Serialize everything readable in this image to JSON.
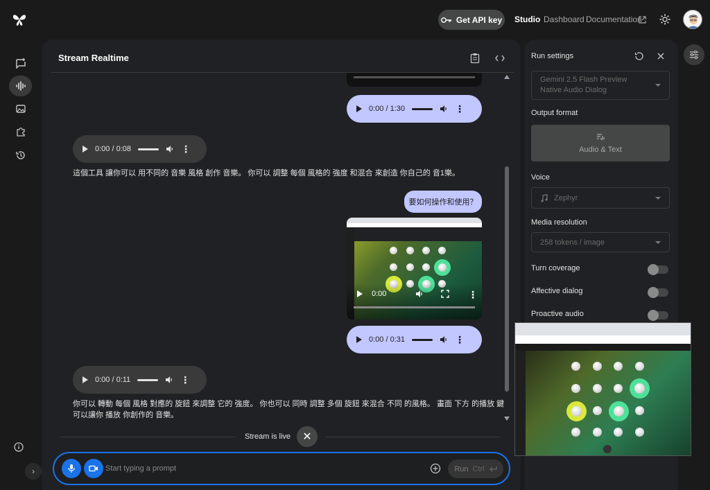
{
  "header": {
    "api_key_label": "Get API key",
    "nav": [
      "Studio",
      "Dashboard",
      "Documentation"
    ]
  },
  "main": {
    "title": "Stream Realtime",
    "messages": {
      "audio1_time": "0:00 / 1:30",
      "audio2_time": "0:00 / 0:08",
      "text1": "這個工具 讓你可以 用不同的 音樂 風格 創作 音樂。 你可以 調整 每個 風格的 強度 和混合 來創造 你自己的 音1樂。",
      "user_question": "要如何操作和使用？",
      "video_time": "0:00",
      "audio3_time": "0:00 / 0:31",
      "audio4_time": "0:00 / 0:11",
      "text2_line1": "你可以 轉動 每個 風格 對應的 旋鈕 來調整 它的 強度。 你也可以 同時 調整 多個 旋鈕 來混合 不同 的風格。 畫面 下方 的播放 鍵",
      "text2_line2": "可以讓你 播放 你創作的 音樂。"
    },
    "live_status": "Stream is live",
    "prompt_placeholder": "Start typing a prompt",
    "run_label": "Run",
    "run_shortcut": "Ctrl"
  },
  "settings": {
    "title": "Run settings",
    "model": "Gemini 2.5 Flash Preview Native Audio Dialog",
    "output_format_label": "Output format",
    "output_format_value": "Audio & Text",
    "voice_label": "Voice",
    "voice_value": "Zephyr",
    "media_resolution_label": "Media resolution",
    "media_resolution_value": "258 tokens / image",
    "toggles": [
      {
        "label": "Turn coverage",
        "on": false
      },
      {
        "label": "Affective dialog",
        "on": false
      },
      {
        "label": "Proactive audio",
        "on": false
      }
    ]
  },
  "colors": {
    "accent": "#1a73e8",
    "user_bubble": "#c2c7ff"
  }
}
